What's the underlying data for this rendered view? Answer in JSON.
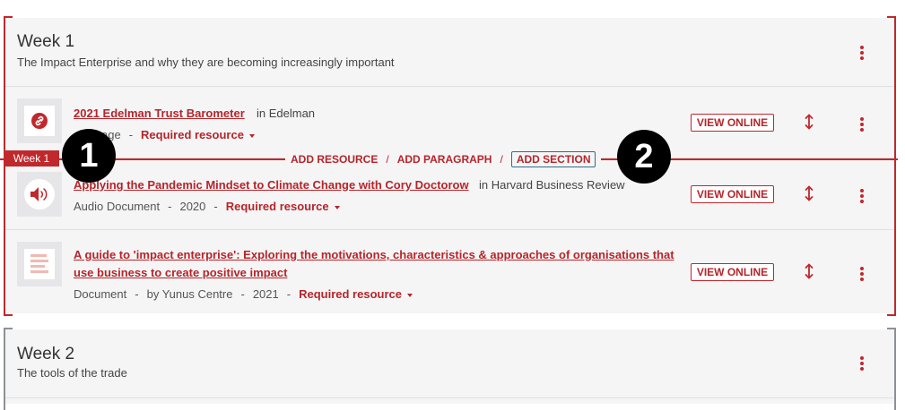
{
  "weeks": [
    {
      "title": "Week 1",
      "subtitle": "The Impact Enterprise and why they are becoming increasingly important",
      "resources": [
        {
          "title": "2021 Edelman Trust Barometer",
          "source": "in Edelman",
          "meta_partial": "age",
          "status": "Required resource",
          "view_label": "VIEW ONLINE",
          "icon": "link-icon"
        },
        {
          "title": "Applying the Pandemic Mindset to Climate Change with Cory Doctorow",
          "source": "in Harvard Business Review",
          "type": "Audio Document",
          "year": "2020",
          "status": "Required resource",
          "view_label": "VIEW ONLINE",
          "icon": "speaker-icon"
        },
        {
          "title_line1": "A guide to 'impact enterprise': Exploring the motivations, characteristics & approaches of organisations that",
          "title_line2": "use business to create positive impact",
          "type": "Document",
          "author": "by Yunus Centre",
          "year": "2021",
          "status": "Required resource",
          "view_label": "VIEW ONLINE",
          "icon": "document-icon"
        }
      ]
    },
    {
      "title": "Week 2",
      "subtitle": "The tools of the trade"
    }
  ],
  "insert_bar": {
    "week_flag": "Week 1",
    "add_resource": "ADD RESOURCE",
    "add_paragraph": "ADD PARAGRAPH",
    "add_section": "ADD SECTION",
    "separator": "/"
  },
  "annotations": {
    "badge_1": "1",
    "badge_2": "2"
  },
  "separators": {
    "dash": "-"
  },
  "colors": {
    "accent": "#c0282c",
    "panel_bg": "#f5f5f6",
    "bracket_grey": "#8d9196",
    "focus_outline": "#2c6f8c"
  }
}
